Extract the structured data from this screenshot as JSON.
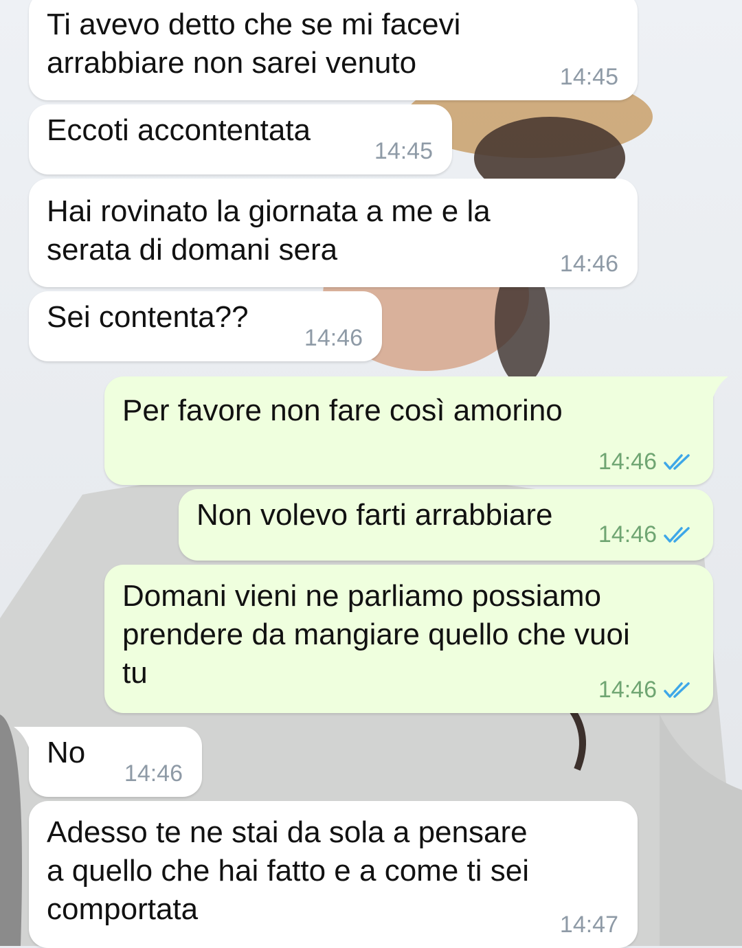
{
  "conversation": {
    "messages": [
      {
        "text": "Ti avevo detto che se mi facevi\narrabbiare non sarei venuto",
        "time": "14:45"
      },
      {
        "text": "Eccoti accontentata",
        "time": "14:45"
      },
      {
        "text": "Hai rovinato la giornata a me e la\nserata di domani sera",
        "time": "14:46"
      },
      {
        "text": "Sei contenta??",
        "time": "14:46"
      },
      {
        "text": "Per favore non fare così amorino",
        "time": "14:46"
      },
      {
        "text": "Non volevo farti arrabbiare",
        "time": "14:46"
      },
      {
        "text": "Domani vieni ne parliamo possiamo\nprendere da mangiare quello che vuoi\ntu",
        "time": "14:46"
      },
      {
        "text": "No",
        "time": "14:46"
      },
      {
        "text": "Adesso te ne stai da sola a pensare\na quello che hai fatto e a come ti sei\ncomportata",
        "time": "14:47"
      }
    ]
  },
  "colors": {
    "incoming_bubble": "#ffffff",
    "outgoing_bubble": "#efffde",
    "read_ticks": "#3ea7e8",
    "timestamp": "#8e9aa6"
  },
  "icons": {
    "read_receipt": "double-check-icon"
  }
}
